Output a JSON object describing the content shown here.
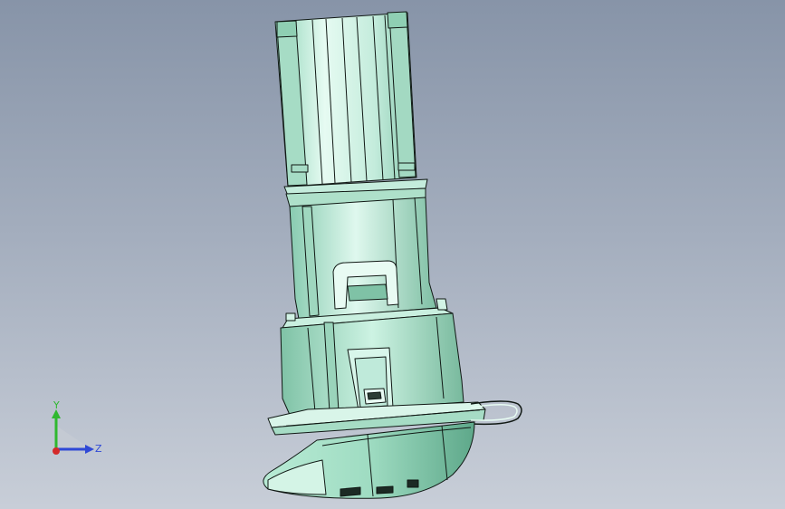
{
  "viewport": {
    "background_top": "#8794a8",
    "background_bottom": "#c8ced8",
    "part_color": "#b9e8d2",
    "edge_color": "#101814"
  },
  "triad": {
    "y_label": "Y",
    "z_label": "Z",
    "y_color": "#2fb82f",
    "z_color": "#2f49d6",
    "x_color": "#d42a2a"
  }
}
